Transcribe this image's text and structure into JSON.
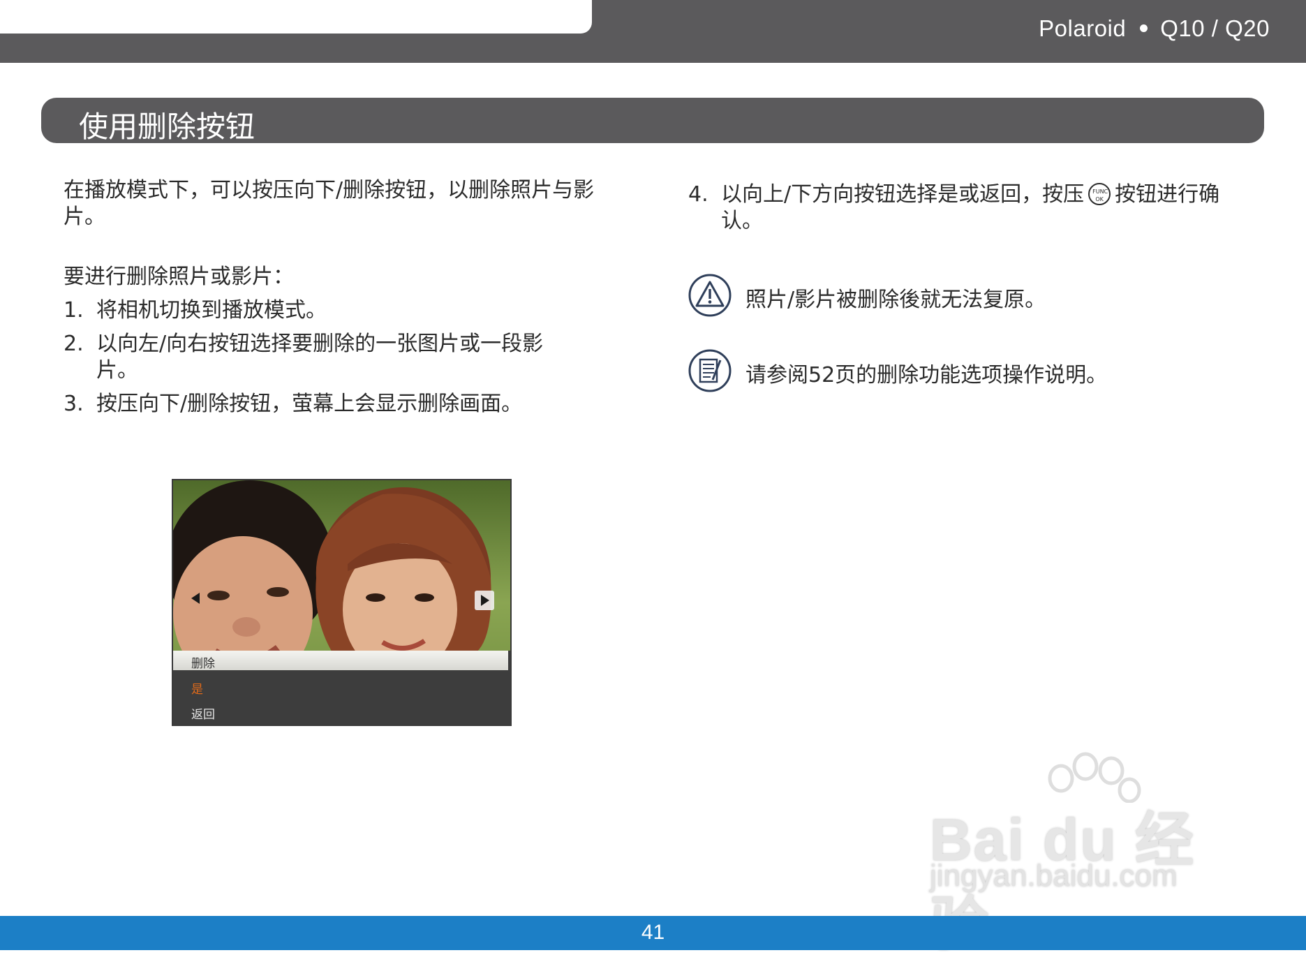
{
  "header": {
    "brand": "Polaroid",
    "model": "Q10 / Q20"
  },
  "section": {
    "title": "使用删除按钮"
  },
  "left": {
    "intro": "在播放模式下，可以按压向下/删除按钮，以删除照片与影片。",
    "subhead": "要进行删除照片或影片：",
    "steps": [
      {
        "num": "1.",
        "text": "将相机切换到播放模式。"
      },
      {
        "num": "2.",
        "text": "以向左/向右按钮选择要删除的一张图片或一段影片。"
      },
      {
        "num": "3.",
        "text": "按压向下/删除按钮，萤幕上会显示删除画面。"
      }
    ]
  },
  "right": {
    "step4": {
      "num": "4.",
      "text_before": "以向上/下方向按钮选择是或返回，按压",
      "button_label": "FUNC OK",
      "text_after": "按钮进行确认。"
    },
    "warning": {
      "icon": "warning-icon",
      "text": "照片/影片被删除後就无法复原。"
    },
    "memo": {
      "icon": "memo-icon",
      "text": "请参阅52页的删除功能选项操作说明。"
    }
  },
  "camera_screen": {
    "menu_title": "删除",
    "option_yes": "是",
    "option_back": "返回",
    "selected_color": "#e06a1a"
  },
  "watermark": {
    "logo": "Bai du 经验",
    "url": "jingyan.baidu.com"
  },
  "footer": {
    "page_number": "41",
    "color": "#1c7fc6"
  }
}
